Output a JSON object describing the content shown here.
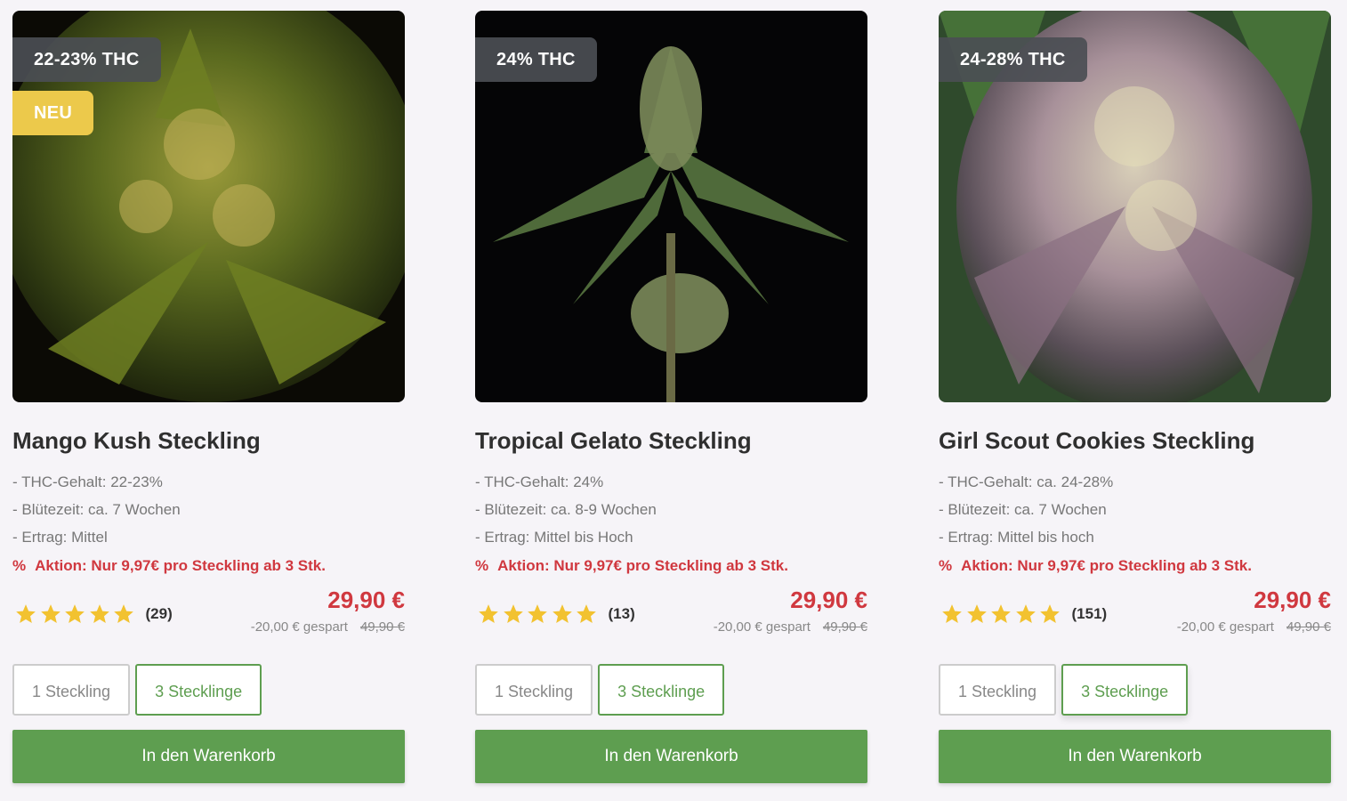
{
  "products": [
    {
      "thc_badge": "22-23% THC",
      "new_badge": "NEU",
      "image_label": "mango-kush-plant",
      "title": "Mango Kush Steckling",
      "specs": [
        "- THC-Gehalt: 22-23%",
        "- Blütezeit: ca. 7 Wochen",
        "- Ertrag: Mittel"
      ],
      "promo_icon": "%",
      "promo": "Aktion: Nur 9,97€ pro Steckling ab 3 Stk.",
      "rating": 5,
      "reviews": "(29)",
      "price": "29,90 €",
      "saved": "-20,00 € gespart",
      "old_price": "49,90 €",
      "variant_1": "1 Steckling",
      "variant_3": "3 Stecklinge",
      "selected_variant": "3 Stecklinge",
      "cart": "In den Warenkorb"
    },
    {
      "thc_badge": "24% THC",
      "image_label": "tropical-gelato-plant",
      "title": "Tropical Gelato Steckling",
      "specs": [
        "- THC-Gehalt: 24%",
        "- Blütezeit: ca. 8-9 Wochen",
        "- Ertrag: Mittel bis Hoch"
      ],
      "promo_icon": "%",
      "promo": "Aktion: Nur 9,97€ pro Steckling ab 3 Stk.",
      "rating": 5,
      "reviews": "(13)",
      "price": "29,90 €",
      "saved": "-20,00 € gespart",
      "old_price": "49,90 €",
      "variant_1": "1 Steckling",
      "variant_3": "3 Stecklinge",
      "selected_variant": "3 Stecklinge",
      "cart": "In den Warenkorb"
    },
    {
      "thc_badge": "24-28% THC",
      "image_label": "girl-scout-cookies-plant",
      "title": "Girl Scout Cookies Steckling",
      "specs": [
        "- THC-Gehalt: ca. 24-28%",
        "- Blütezeit: ca. 7 Wochen",
        "- Ertrag: Mittel bis hoch"
      ],
      "promo_icon": "%",
      "promo": "Aktion: Nur 9,97€ pro Steckling ab 3 Stk.",
      "rating": 5,
      "reviews": "(151)",
      "price": "29,90 €",
      "saved": "-20,00 € gespart",
      "old_price": "49,90 €",
      "variant_1": "1 Steckling",
      "variant_3": "3 Stecklinge",
      "selected_variant": "3 Stecklinge",
      "cart": "In den Warenkorb"
    }
  ],
  "colors": {
    "accent_green": "#5e9e50",
    "promo_red": "#d0383f",
    "badge_dark": "#4b4e54",
    "badge_yellow": "#ecc94b",
    "star_gold": "#f2c230"
  }
}
